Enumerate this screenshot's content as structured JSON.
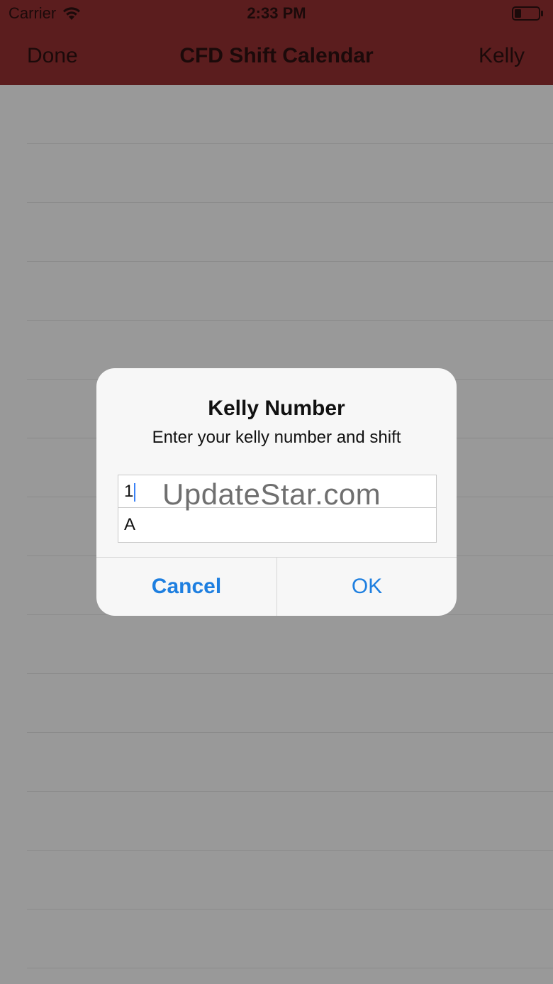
{
  "status_bar": {
    "carrier": "Carrier",
    "time": "2:33 PM",
    "wifi_icon": "wifi-icon",
    "battery_icon": "battery-icon"
  },
  "nav_bar": {
    "left_button": "Done",
    "title": "CFD Shift Calendar",
    "right_button": "Kelly",
    "background_color": "#5b1d1e"
  },
  "alert": {
    "title": "Kelly Number",
    "message": "Enter your kelly number and shift",
    "fields": [
      {
        "value": "1"
      },
      {
        "value": "A"
      }
    ],
    "buttons": {
      "cancel": "Cancel",
      "ok": "OK"
    },
    "accent_color": "#1e7fe0"
  },
  "watermark": "UpdateStar.com"
}
